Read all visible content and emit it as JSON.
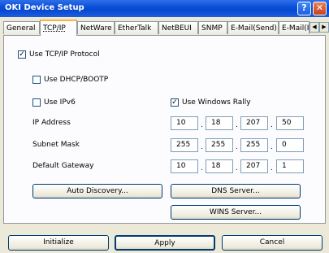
{
  "window": {
    "title": "OKI Device Setup",
    "help_glyph": "?",
    "close_glyph": "✕"
  },
  "tabs": [
    {
      "label": "General"
    },
    {
      "label": "TCP/IP"
    },
    {
      "label": "NetWare"
    },
    {
      "label": "EtherTalk"
    },
    {
      "label": "NetBEUI"
    },
    {
      "label": "SNMP"
    },
    {
      "label": "E-Mail(Send)"
    },
    {
      "label": "E-Mail(I"
    }
  ],
  "tab_scroll": {
    "left": "◀",
    "right": "▶"
  },
  "options": {
    "use_tcpip": {
      "label": "Use TCP/IP Protocol",
      "checked": "✓"
    },
    "use_dhcp": {
      "label": "Use DHCP/BOOTP",
      "checked": ""
    },
    "use_ipv6": {
      "label": "Use IPv6",
      "checked": ""
    },
    "use_rally": {
      "label": "Use Windows Rally",
      "checked": "✓"
    }
  },
  "addresses": {
    "ip": {
      "label": "IP Address",
      "octets": [
        "10",
        "18",
        "207",
        "50"
      ]
    },
    "subnet": {
      "label": "Subnet Mask",
      "octets": [
        "255",
        "255",
        "255",
        "0"
      ]
    },
    "gateway": {
      "label": "Default Gateway",
      "octets": [
        "10",
        "18",
        "207",
        "1"
      ]
    }
  },
  "buttons": {
    "auto_discovery": "Auto Discovery...",
    "dns": "DNS Server...",
    "wins": "WINS Server...",
    "initialize": "Initialize",
    "apply": "Apply",
    "cancel": "Cancel"
  }
}
